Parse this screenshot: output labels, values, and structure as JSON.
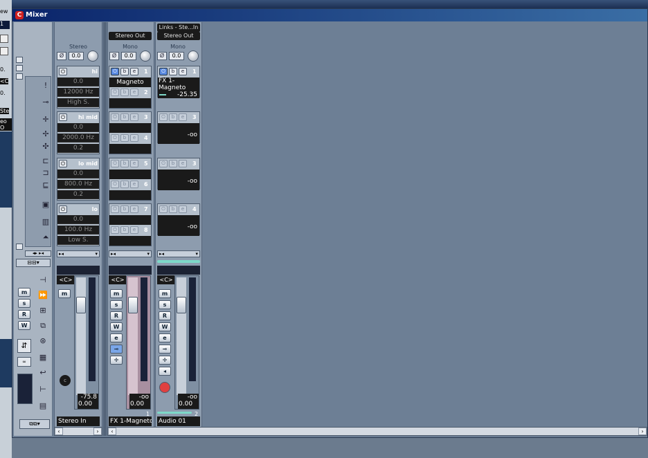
{
  "window": {
    "title": "Mixer"
  },
  "left_strip_texts": [
    "ew",
    "1",
    "0.",
    "<C",
    "0.",
    "Ste",
    "eo O"
  ],
  "channels": [
    {
      "id": "stereo-in",
      "header": "",
      "kind": "Stereo",
      "phase_value": "0.0",
      "eq": [
        {
          "name": "hi",
          "gain": "0.0",
          "freq": "12000 Hz",
          "q": "High S."
        },
        {
          "name": "hi mid",
          "gain": "0.0",
          "freq": "2000.0 Hz",
          "q": "0.2"
        },
        {
          "name": "lo mid",
          "gain": "0.0",
          "freq": "800.0 Hz",
          "q": "0.2"
        },
        {
          "name": "lo",
          "gain": "0.0",
          "freq": "100.0 Hz",
          "q": "Low S."
        }
      ],
      "pan": "<C>",
      "volume": "0.00",
      "peak": "-75.8",
      "name": "Stereo In",
      "number": ""
    },
    {
      "id": "fx1-magneto",
      "header": "Stereo Out",
      "kind": "Mono",
      "phase_value": "0.0",
      "inserts": [
        {
          "num": "1",
          "label": "Magneto"
        },
        {
          "num": "2",
          "label": ""
        },
        {
          "num": "3",
          "label": ""
        },
        {
          "num": "4",
          "label": ""
        },
        {
          "num": "5",
          "label": ""
        },
        {
          "num": "6",
          "label": ""
        },
        {
          "num": "7",
          "label": ""
        },
        {
          "num": "8",
          "label": ""
        }
      ],
      "pan": "<C>",
      "volume": "0.00",
      "peak": "-oo",
      "name": "FX 1-Magneto",
      "number": "1"
    },
    {
      "id": "audio-01",
      "header_top": "Links - Ste...In",
      "header": "Stereo Out",
      "kind": "Mono",
      "phase_value": "0.0",
      "sends": [
        {
          "num": "1",
          "label": "FX 1-Magneto",
          "level": "-25.35"
        },
        {
          "num": "3",
          "label": "",
          "level": "-oo"
        },
        {
          "num": "3",
          "label": "",
          "level": "-oo"
        },
        {
          "num": "4",
          "label": "",
          "level": "-oo"
        }
      ],
      "pan": "<C>",
      "volume": "0.00",
      "peak": "-oo",
      "name": "Audio 01",
      "number": "2"
    }
  ],
  "buttons": {
    "mute": "m",
    "solo": "s",
    "read": "R",
    "write": "W",
    "edit": "e",
    "left_m": "m",
    "left_s": "s",
    "left_r": "R",
    "left_w": "W"
  }
}
